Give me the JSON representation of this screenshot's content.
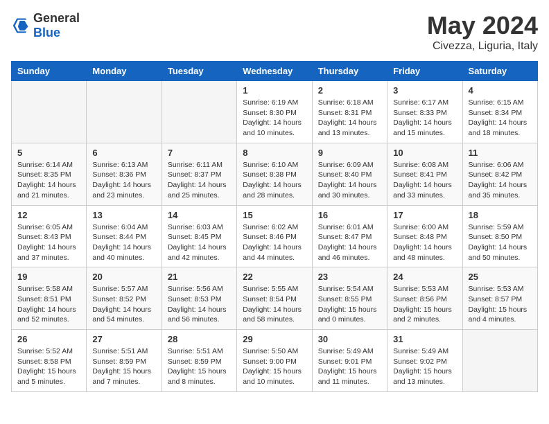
{
  "header": {
    "logo_general": "General",
    "logo_blue": "Blue",
    "month": "May 2024",
    "location": "Civezza, Liguria, Italy"
  },
  "weekdays": [
    "Sunday",
    "Monday",
    "Tuesday",
    "Wednesday",
    "Thursday",
    "Friday",
    "Saturday"
  ],
  "weeks": [
    [
      {
        "day": "",
        "info": ""
      },
      {
        "day": "",
        "info": ""
      },
      {
        "day": "",
        "info": ""
      },
      {
        "day": "1",
        "info": "Sunrise: 6:19 AM\nSunset: 8:30 PM\nDaylight: 14 hours\nand 10 minutes."
      },
      {
        "day": "2",
        "info": "Sunrise: 6:18 AM\nSunset: 8:31 PM\nDaylight: 14 hours\nand 13 minutes."
      },
      {
        "day": "3",
        "info": "Sunrise: 6:17 AM\nSunset: 8:33 PM\nDaylight: 14 hours\nand 15 minutes."
      },
      {
        "day": "4",
        "info": "Sunrise: 6:15 AM\nSunset: 8:34 PM\nDaylight: 14 hours\nand 18 minutes."
      }
    ],
    [
      {
        "day": "5",
        "info": "Sunrise: 6:14 AM\nSunset: 8:35 PM\nDaylight: 14 hours\nand 21 minutes."
      },
      {
        "day": "6",
        "info": "Sunrise: 6:13 AM\nSunset: 8:36 PM\nDaylight: 14 hours\nand 23 minutes."
      },
      {
        "day": "7",
        "info": "Sunrise: 6:11 AM\nSunset: 8:37 PM\nDaylight: 14 hours\nand 25 minutes."
      },
      {
        "day": "8",
        "info": "Sunrise: 6:10 AM\nSunset: 8:38 PM\nDaylight: 14 hours\nand 28 minutes."
      },
      {
        "day": "9",
        "info": "Sunrise: 6:09 AM\nSunset: 8:40 PM\nDaylight: 14 hours\nand 30 minutes."
      },
      {
        "day": "10",
        "info": "Sunrise: 6:08 AM\nSunset: 8:41 PM\nDaylight: 14 hours\nand 33 minutes."
      },
      {
        "day": "11",
        "info": "Sunrise: 6:06 AM\nSunset: 8:42 PM\nDaylight: 14 hours\nand 35 minutes."
      }
    ],
    [
      {
        "day": "12",
        "info": "Sunrise: 6:05 AM\nSunset: 8:43 PM\nDaylight: 14 hours\nand 37 minutes."
      },
      {
        "day": "13",
        "info": "Sunrise: 6:04 AM\nSunset: 8:44 PM\nDaylight: 14 hours\nand 40 minutes."
      },
      {
        "day": "14",
        "info": "Sunrise: 6:03 AM\nSunset: 8:45 PM\nDaylight: 14 hours\nand 42 minutes."
      },
      {
        "day": "15",
        "info": "Sunrise: 6:02 AM\nSunset: 8:46 PM\nDaylight: 14 hours\nand 44 minutes."
      },
      {
        "day": "16",
        "info": "Sunrise: 6:01 AM\nSunset: 8:47 PM\nDaylight: 14 hours\nand 46 minutes."
      },
      {
        "day": "17",
        "info": "Sunrise: 6:00 AM\nSunset: 8:48 PM\nDaylight: 14 hours\nand 48 minutes."
      },
      {
        "day": "18",
        "info": "Sunrise: 5:59 AM\nSunset: 8:50 PM\nDaylight: 14 hours\nand 50 minutes."
      }
    ],
    [
      {
        "day": "19",
        "info": "Sunrise: 5:58 AM\nSunset: 8:51 PM\nDaylight: 14 hours\nand 52 minutes."
      },
      {
        "day": "20",
        "info": "Sunrise: 5:57 AM\nSunset: 8:52 PM\nDaylight: 14 hours\nand 54 minutes."
      },
      {
        "day": "21",
        "info": "Sunrise: 5:56 AM\nSunset: 8:53 PM\nDaylight: 14 hours\nand 56 minutes."
      },
      {
        "day": "22",
        "info": "Sunrise: 5:55 AM\nSunset: 8:54 PM\nDaylight: 14 hours\nand 58 minutes."
      },
      {
        "day": "23",
        "info": "Sunrise: 5:54 AM\nSunset: 8:55 PM\nDaylight: 15 hours\nand 0 minutes."
      },
      {
        "day": "24",
        "info": "Sunrise: 5:53 AM\nSunset: 8:56 PM\nDaylight: 15 hours\nand 2 minutes."
      },
      {
        "day": "25",
        "info": "Sunrise: 5:53 AM\nSunset: 8:57 PM\nDaylight: 15 hours\nand 4 minutes."
      }
    ],
    [
      {
        "day": "26",
        "info": "Sunrise: 5:52 AM\nSunset: 8:58 PM\nDaylight: 15 hours\nand 5 minutes."
      },
      {
        "day": "27",
        "info": "Sunrise: 5:51 AM\nSunset: 8:59 PM\nDaylight: 15 hours\nand 7 minutes."
      },
      {
        "day": "28",
        "info": "Sunrise: 5:51 AM\nSunset: 8:59 PM\nDaylight: 15 hours\nand 8 minutes."
      },
      {
        "day": "29",
        "info": "Sunrise: 5:50 AM\nSunset: 9:00 PM\nDaylight: 15 hours\nand 10 minutes."
      },
      {
        "day": "30",
        "info": "Sunrise: 5:49 AM\nSunset: 9:01 PM\nDaylight: 15 hours\nand 11 minutes."
      },
      {
        "day": "31",
        "info": "Sunrise: 5:49 AM\nSunset: 9:02 PM\nDaylight: 15 hours\nand 13 minutes."
      },
      {
        "day": "",
        "info": ""
      }
    ]
  ]
}
